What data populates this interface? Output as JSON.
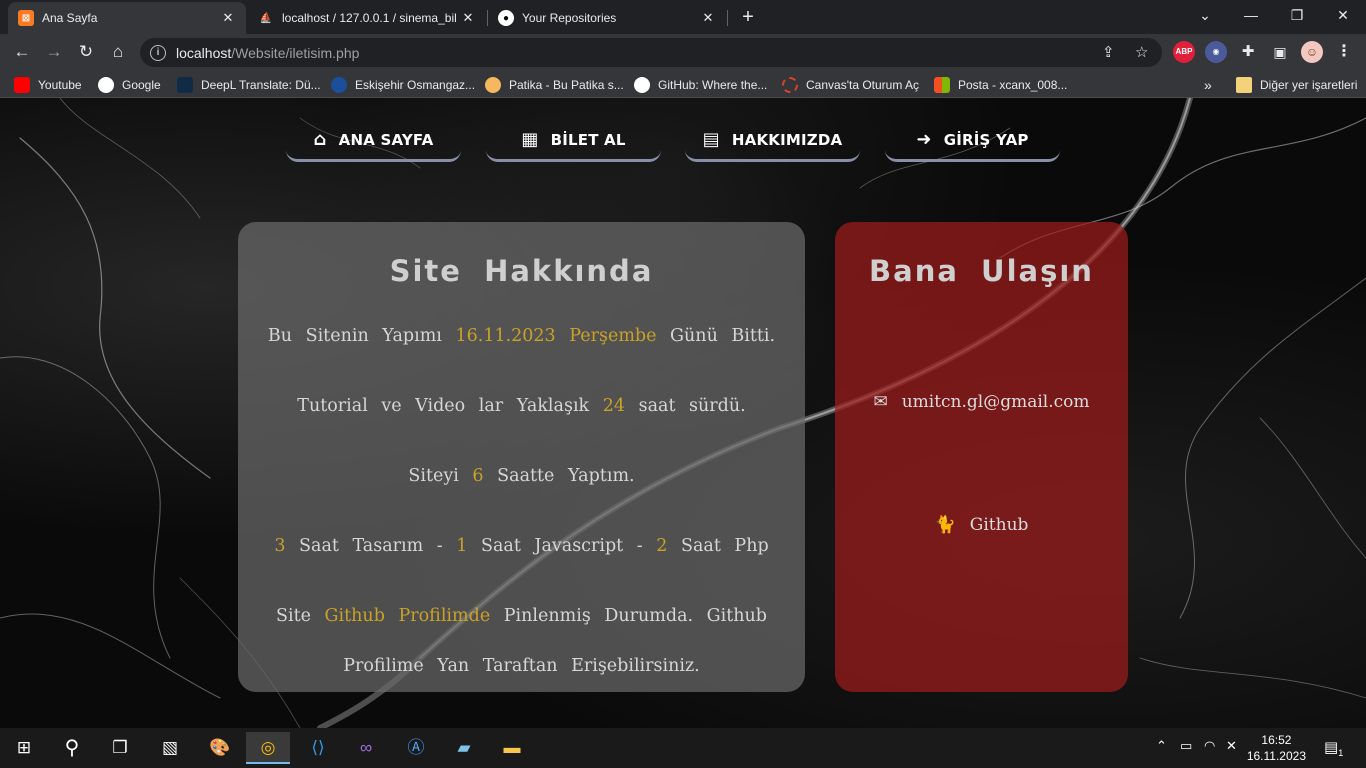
{
  "browser": {
    "tabs": [
      {
        "title": "Ana Sayfa",
        "favicon": "xampp-icon",
        "active": true
      },
      {
        "title": "localhost / 127.0.0.1 / sinema_bil",
        "favicon": "phpmyadmin-icon",
        "active": false
      },
      {
        "title": "Your Repositories",
        "favicon": "github-icon",
        "active": false
      }
    ],
    "url_host": "localhost",
    "url_path": "/Website/iletisim.php",
    "bookmarks": [
      "Youtube",
      "Google",
      "DeepL Translate: Dü...",
      "Eskişehir Osmangaz...",
      "Patika - Bu Patika s...",
      "GitHub: Where the...",
      "Canvas'ta Oturum Aç",
      "Posta - xcanx_008..."
    ],
    "bookmarks_overflow": "»",
    "other_bookmarks": "Diğer yer işaretleri",
    "abp_label": "ABP"
  },
  "nav": [
    {
      "label": "ANA SAYFA",
      "icon": "home-icon"
    },
    {
      "label": "BİLET AL",
      "icon": "film-icon"
    },
    {
      "label": "HAKKIMIZDA",
      "icon": "id-card-icon"
    },
    {
      "label": "GİRİŞ YAP",
      "icon": "sign-in-icon"
    }
  ],
  "about": {
    "title": "Site Hakkında",
    "line1": {
      "a": "Bu Sitenin Yapımı",
      "date": "16.11.2023",
      "day": "Perşembe",
      "b": "Günü Bitti."
    },
    "line2": {
      "a": "Tutorial ve Video lar Yaklaşık",
      "num": "24",
      "b": "saat sürdü."
    },
    "line3": {
      "a": "Siteyi",
      "num": "6",
      "b": "Saatte Yaptım."
    },
    "line4": {
      "n1": "3",
      "t1": "Saat Tasarım -",
      "n2": "1",
      "t2": "Saat Javascript -",
      "n3": "2",
      "t3": "Saat Php"
    },
    "line5": {
      "a": "Site",
      "h1": "Github",
      "h2": "Profilimde",
      "b": "Pinlenmiş Durumda. Github"
    },
    "line6": "Profilime Yan Taraftan Erişebilirsiniz."
  },
  "contact": {
    "title": "Bana Ulaşın",
    "email": "umitcn.gl@gmail.com",
    "github": "Github"
  },
  "taskbar": {
    "time": "16:52",
    "date": "16.11.2023",
    "notification_count": "1"
  },
  "colors": {
    "highlight": "#c9a227",
    "about_card": "rgba(105,105,105,0.72)",
    "contact_card": "rgba(160,28,28,0.72)",
    "nav_underline": "#8a8fa8"
  }
}
